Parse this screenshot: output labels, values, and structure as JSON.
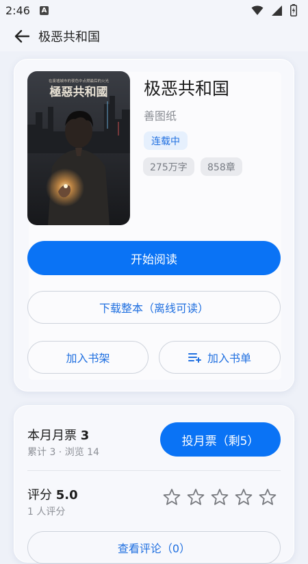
{
  "status_bar": {
    "time": "2:46",
    "notification_badge": "A"
  },
  "header": {
    "title": "极恶共和国"
  },
  "book": {
    "title": "极恶共和国",
    "author": "善图纸",
    "status": "连载中",
    "word_count": "275万字",
    "chapter_count": "858章",
    "cover": {
      "title": "極惡共和國",
      "top_caption": "在废墟城市的夜色中点燃最后的火光"
    }
  },
  "actions": {
    "start_reading": "开始阅读",
    "download": "下载整本（离线可读）",
    "add_shelf": "加入书架",
    "add_booklist": "加入书单"
  },
  "monthly_ticket": {
    "label": "本月月票",
    "count": "3",
    "sub": "累计 3 · 浏览 14",
    "vote_button": "投月票（剩5）"
  },
  "rating": {
    "label": "评分",
    "score": "5.0",
    "sub": "1 人评分",
    "stars_filled": 0,
    "stars_total": 5
  },
  "review_button": "查看评论（0）",
  "colors": {
    "primary": "#0a73f5",
    "accent_text": "#1f6fe0"
  }
}
